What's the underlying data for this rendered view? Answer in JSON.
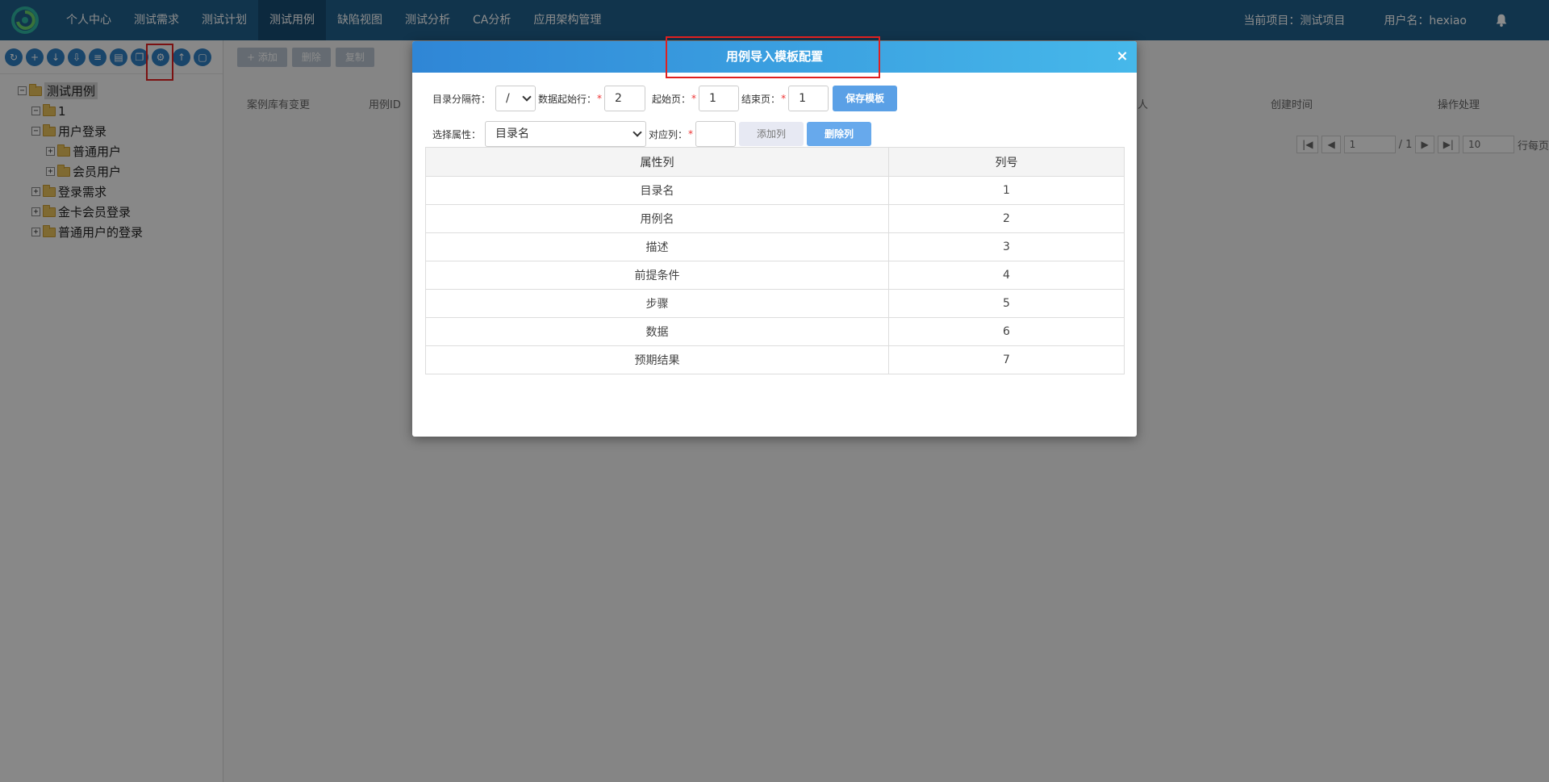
{
  "nav": {
    "items": [
      {
        "label": "个人中心"
      },
      {
        "label": "测试需求"
      },
      {
        "label": "测试计划"
      },
      {
        "label": "测试用例",
        "active": true
      },
      {
        "label": "缺陷视图"
      },
      {
        "label": "测试分析"
      },
      {
        "label": "CA分析"
      },
      {
        "label": "应用架构管理"
      }
    ],
    "project": "当前项目：测试项目",
    "user": "用户名：hexiao"
  },
  "tree": {
    "root": "测试用例",
    "nodes": {
      "n1": "1",
      "n2": "用户登录",
      "n3": "普通用户",
      "n4": "会员用户",
      "n5": "登录需求",
      "n6": "金卡会员登录",
      "n7": "普通用户的登录"
    }
  },
  "main": {
    "toolbar": {
      "add": "+ 添加",
      "delete": "删除",
      "copy": "复制"
    },
    "columns": {
      "c1": "案例库有变更",
      "c2": "用例ID",
      "c3": "人",
      "c4": "创建时间",
      "c5": "操作处理"
    },
    "pager": {
      "page": "1",
      "total": "/ 1",
      "size": "10",
      "unit": "行每页"
    }
  },
  "modal": {
    "title": "用例导入模板配置",
    "close": "×",
    "form": {
      "separator_label": "目录分隔符：",
      "separator_value": "/",
      "start_row_label": "数据起始行：",
      "start_row_value": "2",
      "start_page_label": "起始页：",
      "start_page_value": "1",
      "end_page_label": "结束页：",
      "end_page_value": "1",
      "save_button": "保存模板",
      "attr_label": "选择属性：",
      "attr_value": "目录名",
      "col_label": "对应列：",
      "col_value": "",
      "add_col_button": "添加列",
      "del_col_button": "删除列",
      "required_mark": "*"
    },
    "table": {
      "headers": {
        "attr": "属性列",
        "col": "列号"
      },
      "rows": [
        {
          "attr": "目录名",
          "col": "1"
        },
        {
          "attr": "用例名",
          "col": "2"
        },
        {
          "attr": "描述",
          "col": "3"
        },
        {
          "attr": "前提条件",
          "col": "4"
        },
        {
          "attr": "步骤",
          "col": "5"
        },
        {
          "attr": "数据",
          "col": "6"
        },
        {
          "attr": "预期结果",
          "col": "7"
        }
      ]
    }
  },
  "colors": {
    "nav": "#1f5f8b",
    "modal_header_start": "#2f86d6",
    "modal_header_end": "#46b8ea",
    "highlight": "#e02020"
  }
}
